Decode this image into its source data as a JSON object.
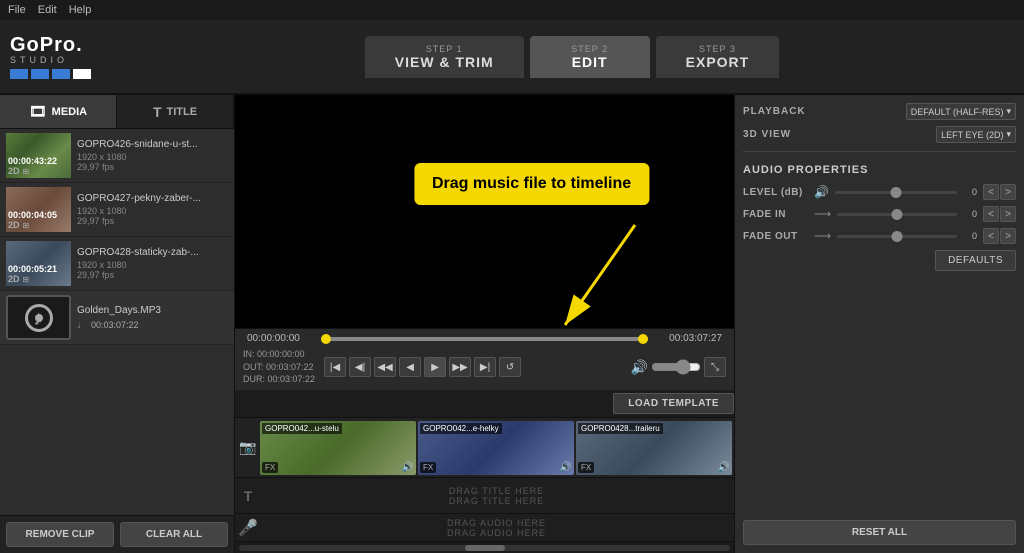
{
  "titlebar": {
    "file": "File",
    "edit": "Edit",
    "help": "Help"
  },
  "header": {
    "logo": "GoPro.",
    "logo_sub": "STUDIO",
    "step1": {
      "num": "STEP 1",
      "label": "VIEW & TRIM"
    },
    "step2": {
      "num": "STEP 2",
      "label": "EDIT"
    },
    "step3": {
      "num": "STEP 3",
      "label": "EXPORT"
    }
  },
  "left_panel": {
    "tab_media": "MEDIA",
    "tab_title": "TITLE",
    "media_items": [
      {
        "name": "GOPRO426-snidane-u-st...",
        "meta": "1920 x 1080",
        "fps": "29,97 fps",
        "duration": "00:00:43:22",
        "badge": "2D"
      },
      {
        "name": "GOPRO427-pekny-zaber-...",
        "meta": "1920 x 1080",
        "fps": "29,97 fps",
        "duration": "00:00:04:05",
        "badge": "2D"
      },
      {
        "name": "GOPRO428-staticky-zab-...",
        "meta": "1920 x 1080",
        "fps": "29,97 fps",
        "duration": "00:00:05:21",
        "badge": "2D"
      },
      {
        "name": "Golden_Days.MP3",
        "duration": "00:03:07:22",
        "is_audio": true
      }
    ],
    "remove_btn": "REMOVE CLIP",
    "clear_btn": "CLEAR ALL"
  },
  "preview": {
    "drag_tooltip": "Drag music file to timeline"
  },
  "timeline": {
    "time_start": "00:00:00:00",
    "time_end": "00:03:07:27",
    "in_label": "IN: 00:00:00:00",
    "out_label": "OUT: 00:03:07:22",
    "dur_label": "DUR: 00:03:07:22",
    "load_template": "LOAD TEMPLATE",
    "clips": [
      {
        "label": "GOPRO042...u-stelu",
        "fx": "FX"
      },
      {
        "label": "GOPRO042...e-helky",
        "fx": "FX"
      },
      {
        "label": "GOPRO0428...traileru",
        "fx": "FX"
      }
    ],
    "title_drag": "DRAG TITLE HERE",
    "title_drag2": "DRAG TITLE HERE",
    "audio_drag": "DRAG AUDIO HERE",
    "audio_drag2": "DRAG AUDIO HERE"
  },
  "right_panel": {
    "playback_label": "PLAYBACK",
    "playback_value": "DEFAULT (HALF-RES)",
    "view_3d_label": "3D VIEW",
    "view_3d_value": "LEFT EYE (2D)",
    "audio_props_title": "AUDIO PROPERTIES",
    "level_label": "LEVEL (dB)",
    "level_value": "0",
    "fade_in_label": "FADE IN",
    "fade_in_value": "0",
    "fade_out_label": "FADE OUT",
    "fade_out_value": "0",
    "defaults_btn": "DEFAULTS",
    "reset_all_btn": "RESET ALL"
  }
}
